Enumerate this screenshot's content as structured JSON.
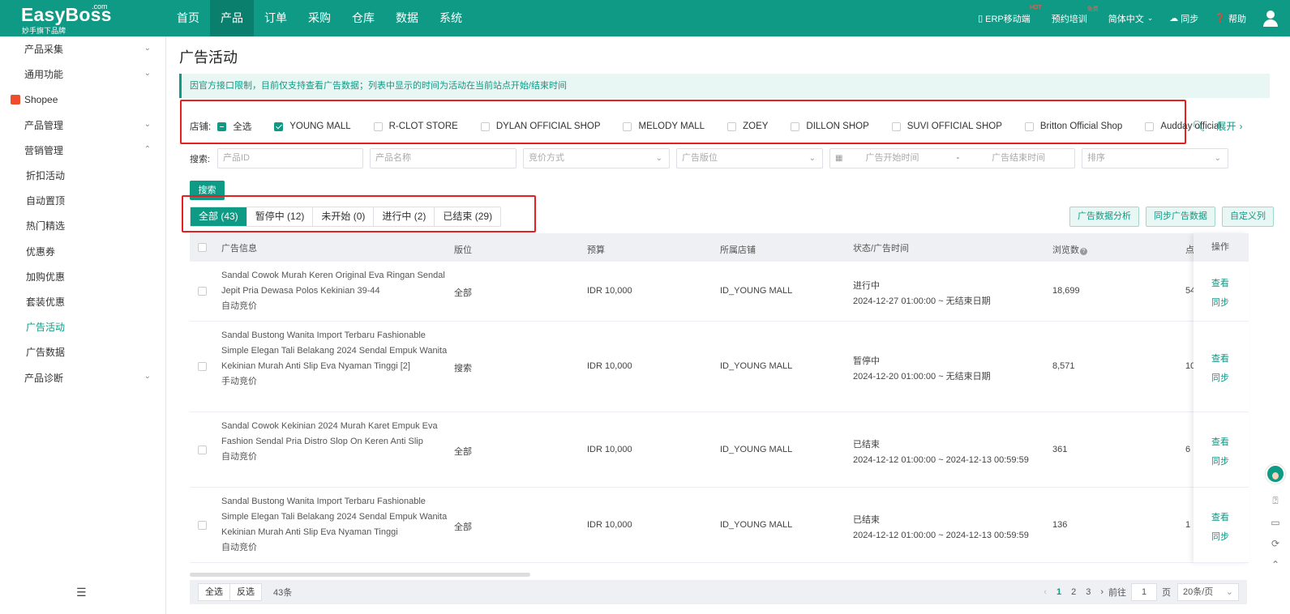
{
  "brand": {
    "name": "EasyBoss",
    "com": ".com",
    "tagline": "妙手旗下品牌"
  },
  "nav": [
    "首页",
    "产品",
    "订单",
    "采购",
    "仓库",
    "数据",
    "系统"
  ],
  "nav_active": 1,
  "top_right": {
    "erp": "ERP移动端",
    "erp_badge": "HOT",
    "training": "预约培训",
    "training_badge": "免费",
    "lang": "简体中文",
    "sync": "同步",
    "help": "帮助"
  },
  "sidebar": {
    "items": [
      {
        "label": "产品采集",
        "type": "group",
        "open": false
      },
      {
        "label": "通用功能",
        "type": "group",
        "open": false
      },
      {
        "label": "Shopee",
        "type": "platform"
      },
      {
        "label": "产品管理",
        "type": "group",
        "open": false
      },
      {
        "label": "营销管理",
        "type": "group",
        "open": true
      },
      {
        "label": "折扣活动",
        "type": "sub"
      },
      {
        "label": "自动置顶",
        "type": "sub"
      },
      {
        "label": "热门精选",
        "type": "sub"
      },
      {
        "label": "优惠券",
        "type": "sub"
      },
      {
        "label": "加购优惠",
        "type": "sub"
      },
      {
        "label": "套装优惠",
        "type": "sub"
      },
      {
        "label": "广告活动",
        "type": "sub",
        "active": true
      },
      {
        "label": "广告数据",
        "type": "sub"
      },
      {
        "label": "产品诊断",
        "type": "group",
        "open": false
      }
    ]
  },
  "page": {
    "title": "广告活动",
    "notice": "因官方接口限制，目前仅支持查看广告数据；列表中显示的时间为活动在当前站点开始/结束时间"
  },
  "stores": {
    "label": "店铺:",
    "select_all": "全选",
    "items": [
      {
        "name": "YOUNG MALL",
        "checked": true
      },
      {
        "name": "R-CLOT STORE",
        "checked": false
      },
      {
        "name": "DYLAN OFFICIAL SHOP",
        "checked": false
      },
      {
        "name": "MELODY MALL",
        "checked": false
      },
      {
        "name": "ZOEY",
        "checked": false
      },
      {
        "name": "DILLON SHOP",
        "checked": false
      },
      {
        "name": "SUVI OFFICIAL SHOP",
        "checked": false
      },
      {
        "name": "Britton Official Shop",
        "checked": false
      },
      {
        "name": "Audday official",
        "checked": false
      }
    ],
    "expand": "展开"
  },
  "search": {
    "label": "搜索:",
    "product_id": "产品ID",
    "product_name": "产品名称",
    "bid_method": "竞价方式",
    "ad_position": "广告版位",
    "start_time": "广告开始时间",
    "date_sep": "-",
    "end_time": "广告结束时间",
    "sort": "排序",
    "button": "搜索"
  },
  "tabs": [
    "全部 (43)",
    "暂停中 (12)",
    "未开始 (0)",
    "进行中 (2)",
    "已结束 (29)"
  ],
  "tab_active": 0,
  "actions": [
    "广告数据分析",
    "同步广告数据",
    "自定义列"
  ],
  "table": {
    "headers": {
      "info": "广告信息",
      "position": "版位",
      "budget": "预算",
      "store": "所属店铺",
      "status": "状态/广告时间",
      "views": "浏览数",
      "extra": "点",
      "ops": "操作"
    },
    "rows": [
      {
        "title": "Sandal Cowok Murah Keren Original Eva Ringan Sendal Jepit Pria Dewasa Polos Kekinian 39-44",
        "bid": "自动竞价",
        "position": "全部",
        "budget": "IDR 10,000",
        "store": "ID_YOUNG MALL",
        "status": "进行中",
        "time": "2024-12-27 01:00:00 ~ 无结束日期",
        "views": "18,699",
        "extra": "54"
      },
      {
        "title": "Sandal Bustong Wanita Import Terbaru Fashionable Simple Elegan Tali Belakang 2024 Sendal Empuk Wanita Kekinian Murah Anti Slip Eva Nyaman Tinggi [2]",
        "bid": "手动竞价",
        "position": "搜索",
        "budget": "IDR 10,000",
        "store": "ID_YOUNG MALL",
        "status": "暂停中",
        "time": "2024-12-20 01:00:00 ~ 无结束日期",
        "views": "8,571",
        "extra": "10"
      },
      {
        "title": "Sandal Cowok Kekinian 2024 Murah Karet Empuk Eva Fashion Sendal Pria Distro Slop On Keren Anti Slip",
        "bid": "自动竞价",
        "position": "全部",
        "budget": "IDR 10,000",
        "store": "ID_YOUNG MALL",
        "status": "已结束",
        "time": "2024-12-12 01:00:00 ~ 2024-12-13 00:59:59",
        "views": "361",
        "extra": "6"
      },
      {
        "title": "Sandal Bustong Wanita Import Terbaru Fashionable Simple Elegan Tali Belakang 2024 Sendal Empuk Wanita Kekinian Murah Anti Slip Eva Nyaman Tinggi",
        "bid": "自动竞价",
        "position": "全部",
        "budget": "IDR 10,000",
        "store": "ID_YOUNG MALL",
        "status": "已结束",
        "time": "2024-12-12 01:00:00 ~ 2024-12-13 00:59:59",
        "views": "136",
        "extra": "1"
      }
    ],
    "op_view": "查看",
    "op_sync": "同步"
  },
  "footer": {
    "select_all": "全选",
    "invert": "反选",
    "count": "43条",
    "pages": [
      "1",
      "2",
      "3"
    ],
    "page_active": 0,
    "goto": "前往",
    "goto_value": "1",
    "page_unit": "页",
    "page_size": "20条/页"
  },
  "colors": {
    "primary": "#0f9a85",
    "highlight": "#e62020"
  }
}
